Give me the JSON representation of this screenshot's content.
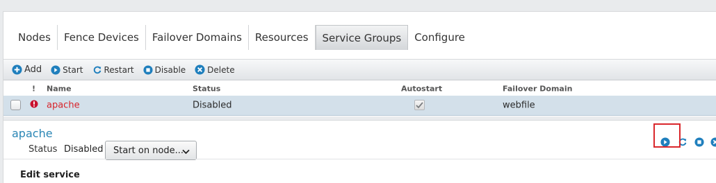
{
  "tabs": [
    {
      "label": "Nodes"
    },
    {
      "label": "Fence Devices"
    },
    {
      "label": "Failover Domains"
    },
    {
      "label": "Resources"
    },
    {
      "label": "Service Groups",
      "active": true
    },
    {
      "label": "Configure"
    }
  ],
  "toolbar": {
    "add_label": "Add",
    "start_label": "Start",
    "restart_label": "Restart",
    "disable_label": "Disable",
    "delete_label": "Delete"
  },
  "grid": {
    "headers": {
      "status_icon": "!",
      "name": "Name",
      "status": "Status",
      "autostart": "Autostart",
      "failover_domain": "Failover Domain"
    },
    "rows": [
      {
        "status_icon": "error-icon",
        "name": "apache",
        "status": "Disabled",
        "autostart": true,
        "failover_domain": "webfile"
      }
    ]
  },
  "detail": {
    "title": "apache",
    "status_label": "Status",
    "status_value": "Disabled",
    "start_select": "Start on node..."
  },
  "edit_section": {
    "title": "Edit service"
  },
  "colors": {
    "accent_blue": "#2a86b5",
    "icon_blue": "#1f7fbd",
    "error_red": "#d8232a",
    "selected_row": "#d3e0ea",
    "highlight_box": "#d9262b"
  }
}
